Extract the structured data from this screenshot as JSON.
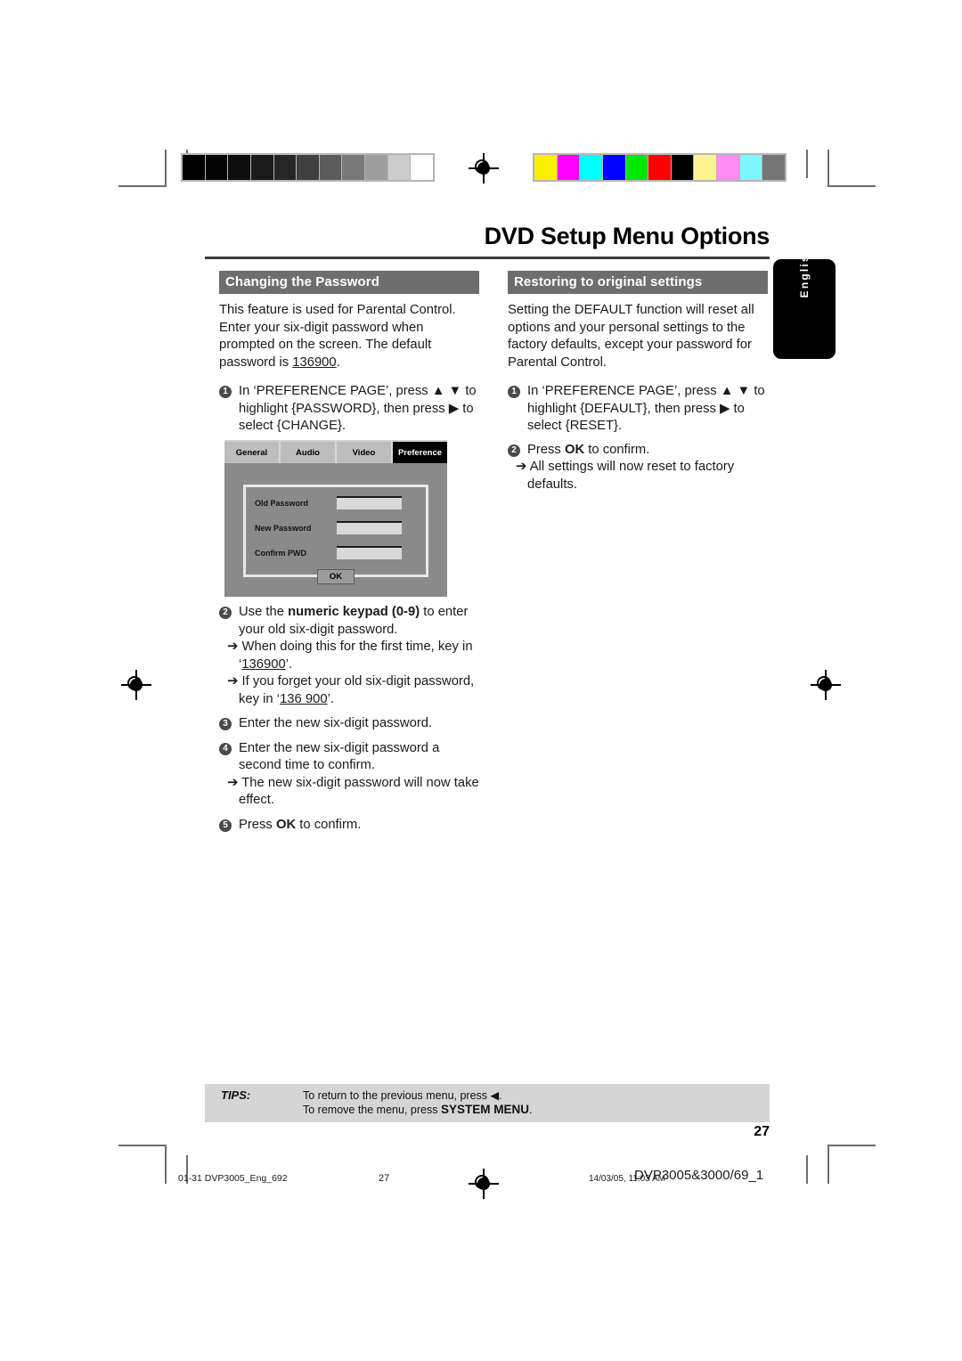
{
  "header": {
    "title": "DVD Setup Menu Options",
    "language_tab": "English"
  },
  "calibration": {
    "grayscale": [
      "#000000",
      "#050505",
      "#0d0d0d",
      "#1a1a1a",
      "#262626",
      "#404040",
      "#5c5c5c",
      "#787878",
      "#9e9e9e",
      "#cccccc",
      "#ffffff"
    ],
    "colors": [
      "#ffef00",
      "#ff00ff",
      "#00ffff",
      "#0000ff",
      "#00e800",
      "#ff0000",
      "#000000",
      "#fff291",
      "#ff8cf0",
      "#7df7ff",
      "#757575"
    ]
  },
  "left_column": {
    "heading": "Changing the Password",
    "intro": "This feature is used for Parental Control. Enter your six-digit password when prompted on the screen. The default password is ",
    "intro_underlined": "136900",
    "intro_end": ".",
    "steps": [
      {
        "num": "1",
        "lines": [
          "In ‘PREFERENCE PAGE’, press ▲ ▼ to",
          "highlight {PASSWORD}, then press ▶ to",
          "select {CHANGE}."
        ]
      },
      {
        "num": "2",
        "line_a": "Use the ",
        "line_a_bold": "numeric keypad (0-9)",
        "line_a_end": " to enter your old six-digit password.",
        "bullet_1": "➔ When doing this for the first time, key in ‘",
        "bullet_1_underlined": "136900",
        "bullet_1_end": "’.",
        "bullet_2": "➔ If you forget your old six-digit password, key in ‘",
        "bullet_2_underlined": "136 900",
        "bullet_2_end": "’."
      },
      {
        "num": "3",
        "text": "Enter the new six-digit password."
      },
      {
        "num": "4",
        "text": "Enter the new six-digit password a second time to confirm.",
        "bullet": "➔ The new six-digit password will now take effect."
      },
      {
        "num": "5",
        "text_a": "Press ",
        "text_bold": "OK",
        "text_b": " to confirm."
      }
    ]
  },
  "right_column": {
    "heading": "Restoring to original settings",
    "intro": "Setting the DEFAULT function will reset all options and your personal settings to the factory defaults, except your password for Parental Control.",
    "steps": [
      {
        "num": "1",
        "lines": [
          "In ‘PREFERENCE PAGE’, press ▲ ▼ to",
          "highlight {DEFAULT}, then press ▶  to",
          "select {RESET}."
        ]
      },
      {
        "num": "2",
        "text_a": "Press ",
        "text_bold": "OK",
        "text_b": " to confirm.",
        "bullet": "➔ All settings will now reset to factory defaults."
      }
    ]
  },
  "tv_screen": {
    "tabs": [
      {
        "label": "General",
        "active": false
      },
      {
        "label": "Audio",
        "active": false
      },
      {
        "label": "Video",
        "active": false
      },
      {
        "label": "Preference",
        "active": true
      }
    ],
    "fields": [
      {
        "label": "Old Password",
        "value": ""
      },
      {
        "label": "New Password",
        "value": ""
      },
      {
        "label": "Confirm PWD",
        "value": ""
      }
    ],
    "ok_button": "OK"
  },
  "tips": {
    "label": "TIPS:",
    "line_1": "To return to the previous menu, press ◀.",
    "line_2_a": "To remove the menu, press ",
    "line_2_bold": "SYSTEM MENU",
    "line_2_end": "."
  },
  "page_number": "27",
  "footer": {
    "file_name": "01-31 DVP3005_Eng_692",
    "page": "27",
    "date": "14/03/05, 11:03 AM",
    "doc_code": "DVP3005&3000/69_1"
  }
}
